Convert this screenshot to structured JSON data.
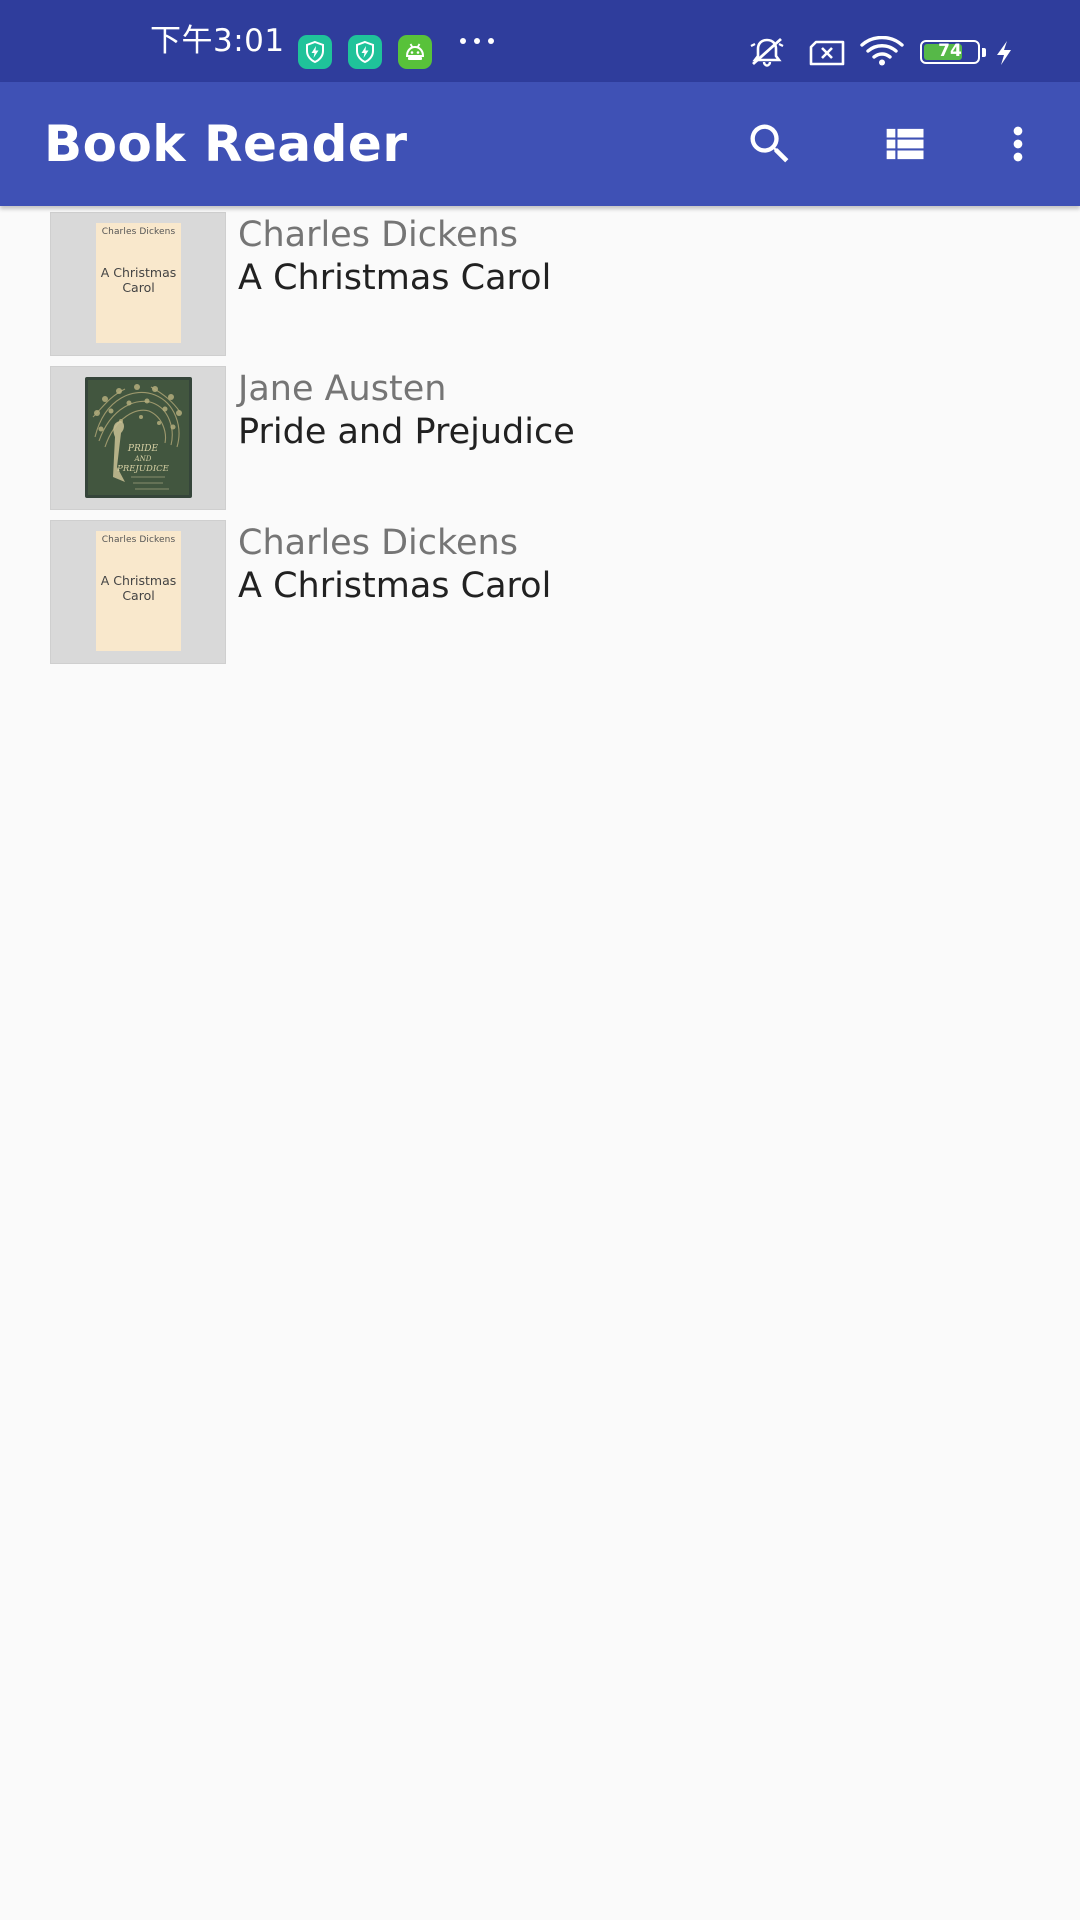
{
  "status_bar": {
    "time": "下午3:01",
    "battery_level": "74",
    "battery_fraction": 0.74,
    "notification_icons": [
      "bolt-shield-icon",
      "bolt-shield-icon",
      "android-icon"
    ],
    "right_icons": [
      "mute-icon",
      "no-sim-icon",
      "wifi-icon",
      "battery-icon",
      "charging-icon"
    ],
    "colors": {
      "background": "#2f3d9c",
      "notif_teal": "#1fc39a",
      "notif_green": "#58c23a",
      "battery_fill": "#56b848"
    }
  },
  "app_bar": {
    "title": "Book Reader",
    "actions": [
      "search-icon",
      "list-view-icon",
      "more-vert-icon"
    ],
    "color": "#3f51b5"
  },
  "books": [
    {
      "author": "Charles Dickens",
      "title": "A Christmas Carol",
      "cover": {
        "type": "plain",
        "author": "Charles Dickens",
        "title": "A Christmas Carol"
      }
    },
    {
      "author": "Jane Austen",
      "title": "Pride and Prejudice",
      "cover": {
        "type": "illustrated",
        "title": "PRIDE AND PREJUDICE"
      }
    },
    {
      "author": "Charles Dickens",
      "title": "A Christmas Carol",
      "cover": {
        "type": "plain",
        "author": "Charles Dickens",
        "title": "A Christmas Carol"
      }
    }
  ]
}
